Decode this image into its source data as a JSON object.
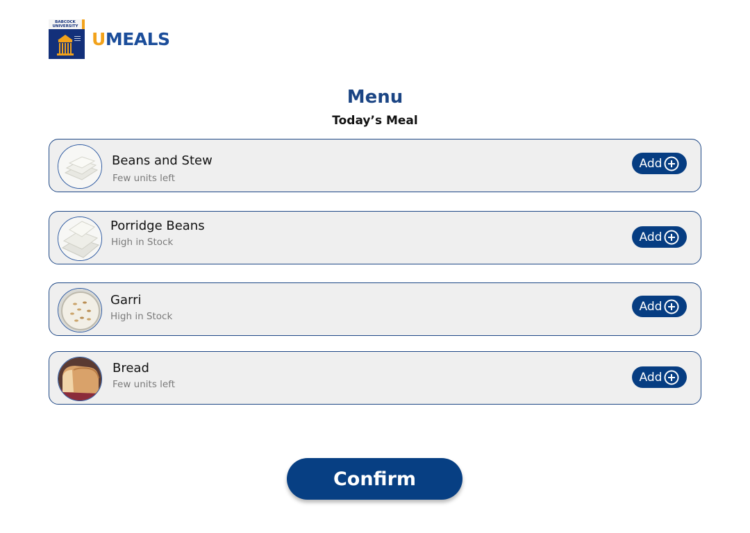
{
  "logo": {
    "badge_text": "BABCOCK UNIVERSITY",
    "brand_u": "U",
    "brand_rest": "MEALS"
  },
  "title": "Menu",
  "subtitle": "Today’s Meal",
  "menu": {
    "items": [
      {
        "name": "Beans and Stew",
        "stock": "Few units left",
        "add_label": "Add",
        "image": "wrapped-meal-packs"
      },
      {
        "name": "Porridge Beans",
        "stock": "High in Stock",
        "add_label": "Add",
        "image": "wrapped-meal-packs"
      },
      {
        "name": "Garri",
        "stock": "High in Stock",
        "add_label": "Add",
        "image": "garri-bowl"
      },
      {
        "name": "Bread",
        "stock": "Few units left",
        "add_label": "Add",
        "image": "bread-loaf"
      }
    ]
  },
  "confirm_label": "Confirm",
  "colors": {
    "primary": "#073f83",
    "title": "#1b4584",
    "accent": "#f2a21b",
    "card_bg": "#efefef"
  }
}
